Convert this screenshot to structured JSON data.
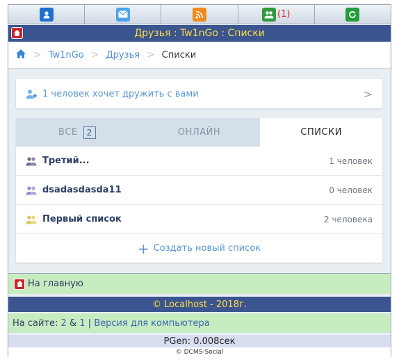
{
  "topbar": {
    "items": [
      {
        "icon": "user-icon"
      },
      {
        "icon": "mail-icon"
      },
      {
        "icon": "rss-icon"
      },
      {
        "icon": "friends-icon",
        "count": "(1)"
      },
      {
        "icon": "refresh-icon"
      }
    ]
  },
  "title": "Друзья : Tw1nGo : Списки",
  "breadcrumb": {
    "items": [
      "Tw1nGo",
      "Друзья",
      "Списки"
    ]
  },
  "friend_request": {
    "text": "1 человек хочет дружить с вами"
  },
  "tabs": [
    {
      "label": "ВСЕ",
      "badge": "2"
    },
    {
      "label": "ОНЛАЙН"
    },
    {
      "label": "СПИСКИ"
    }
  ],
  "lists": [
    {
      "name": "Третий...",
      "count": "1 человек",
      "color": "#6d6a8a"
    },
    {
      "name": "dsadasdasda11",
      "count": "0 человек",
      "color": "#9c88c9"
    },
    {
      "name": "Первый список",
      "count": "2 человека",
      "color": "#d8c85a"
    }
  ],
  "create_list": "Создать новый список",
  "footer": {
    "home_link": "На главную",
    "copyright": "© Localhost - 2018г.",
    "online_prefix": "На сайте:",
    "online_a": "2",
    "online_amp": "&",
    "online_b": "1",
    "online_sep": "|",
    "desktop_link": "Версия для компьютера",
    "pgen": "PGen: 0.008сек",
    "dcms": "© DCMS-Social"
  },
  "colors": {
    "header_blue": "#3b5590",
    "title_yellow": "#ffde45",
    "link_blue": "#4d8fd8",
    "footer_green": "#c7ecc0"
  }
}
